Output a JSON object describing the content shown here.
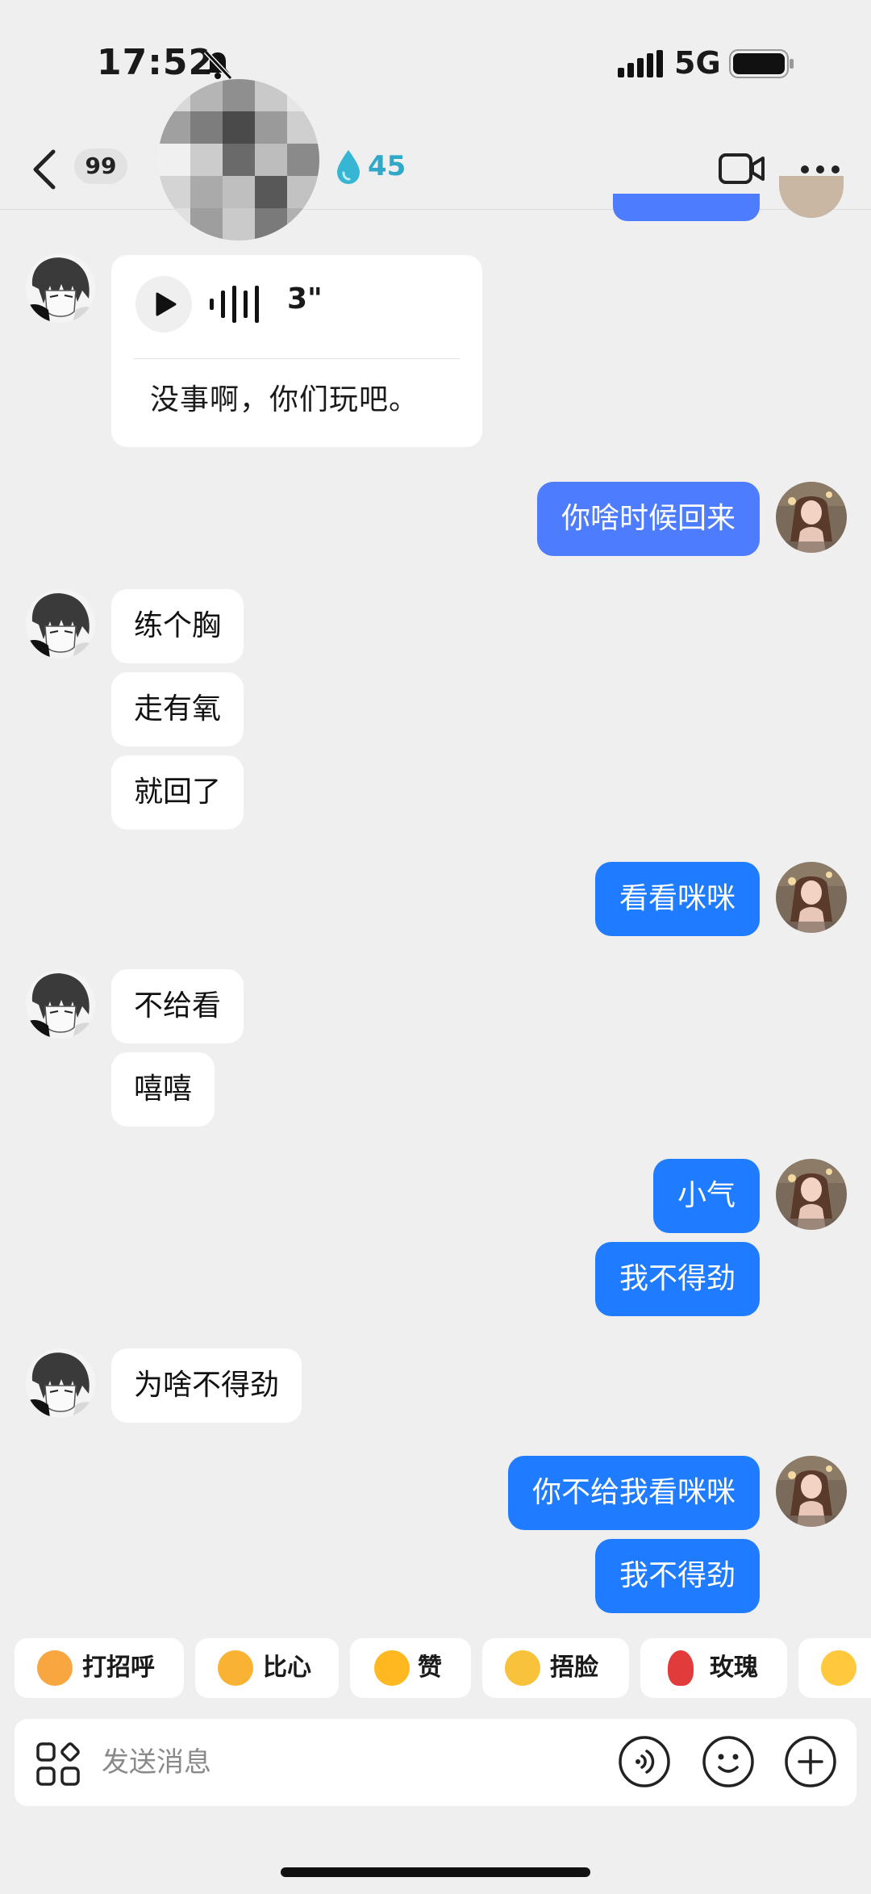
{
  "status_bar": {
    "time": "17:52",
    "network": "5G"
  },
  "header": {
    "unread_count": "99",
    "streak_count": "45"
  },
  "voice_message": {
    "duration": "3\"",
    "transcript": "没事啊，你们玩吧。"
  },
  "messages": [
    {
      "side": "out",
      "text": "你啥时候回来"
    },
    {
      "side": "in",
      "text": "练个胸"
    },
    {
      "side": "in",
      "text": "走有氧"
    },
    {
      "side": "in",
      "text": "就回了"
    },
    {
      "side": "out",
      "text": "看看咪咪"
    },
    {
      "side": "in",
      "text": "不给看"
    },
    {
      "side": "in",
      "text": "嘻嘻"
    },
    {
      "side": "out",
      "text": "小气"
    },
    {
      "side": "out",
      "text": "我不得劲"
    },
    {
      "side": "in",
      "text": "为啥不得劲"
    },
    {
      "side": "out",
      "text": "你不给我看咪咪"
    },
    {
      "side": "out",
      "text": "我不得劲"
    }
  ],
  "quick_reactions": [
    {
      "label": "打招呼",
      "emoji": "waving-emoji"
    },
    {
      "label": "比心",
      "emoji": "heart-hands-emoji"
    },
    {
      "label": "赞",
      "emoji": "thumbs-up-emoji"
    },
    {
      "label": "捂脸",
      "emoji": "facepalm-emoji"
    },
    {
      "label": "玫瑰",
      "emoji": "rose-emoji"
    },
    {
      "label": "",
      "emoji": "clap-emoji"
    }
  ],
  "input": {
    "placeholder": "发送消息"
  },
  "colors": {
    "outgoing_bubble": "#1F7BFF",
    "outgoing_bubble_alt": "#4D7CFE",
    "incoming_bubble": "#FFFFFF",
    "background": "#EFEFEF",
    "streak": "#2FA9C7"
  }
}
